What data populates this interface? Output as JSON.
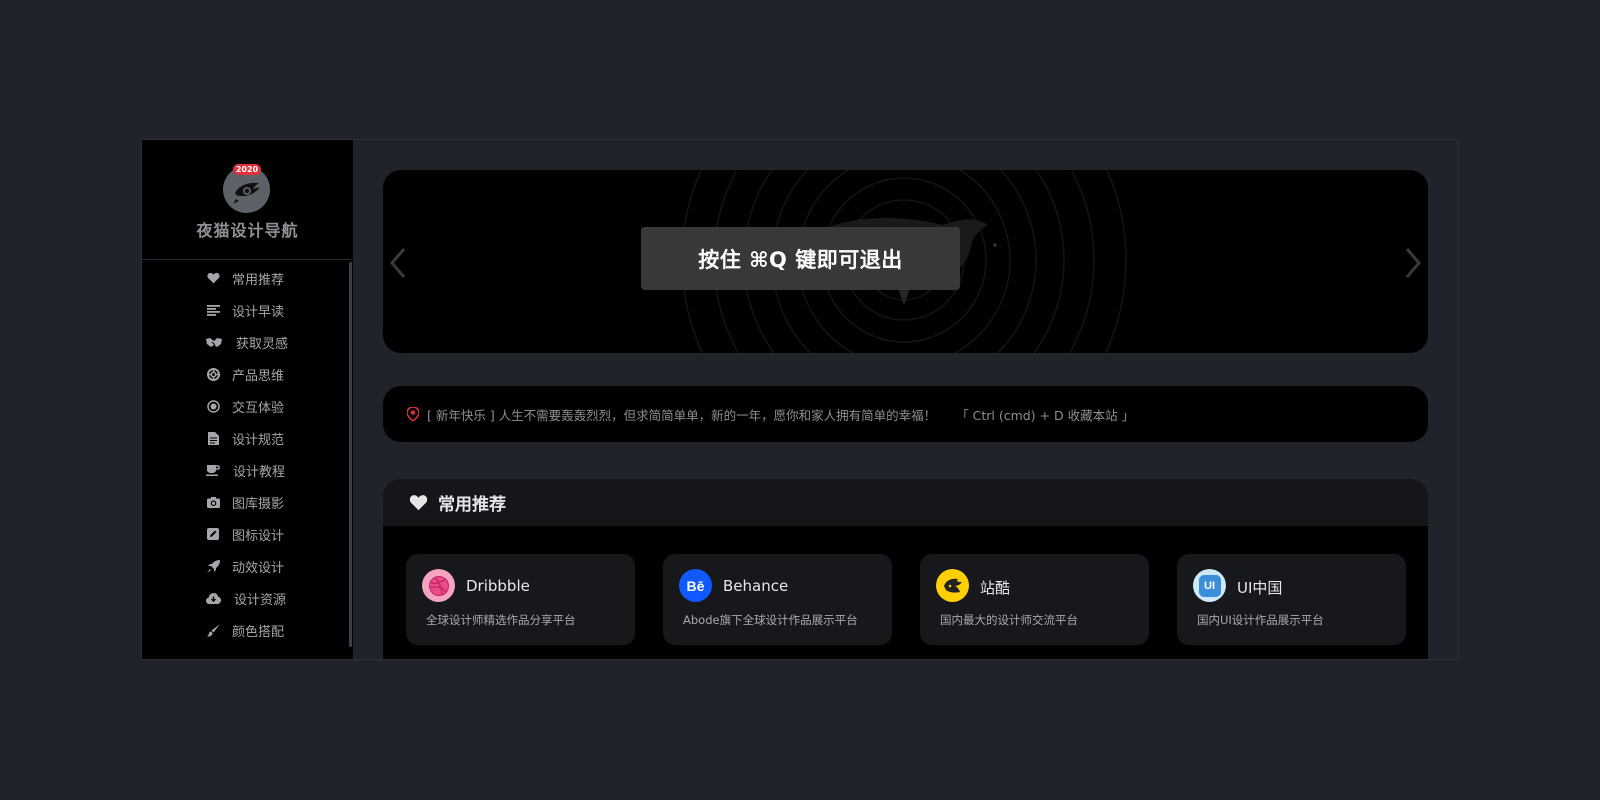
{
  "sidebar": {
    "logo_badge_text": "2020",
    "site_name": "夜猫设计导航",
    "items": [
      {
        "label": "常用推荐",
        "icon": "heart-icon"
      },
      {
        "label": "设计早读",
        "icon": "align-left-icon"
      },
      {
        "label": "获取灵感",
        "icon": "handshake-icon"
      },
      {
        "label": "产品思维",
        "icon": "life-ring-icon"
      },
      {
        "label": "交互体验",
        "icon": "dot-circle-icon"
      },
      {
        "label": "设计规范",
        "icon": "file-icon"
      },
      {
        "label": "设计教程",
        "icon": "coffee-cup-icon"
      },
      {
        "label": "图库摄影",
        "icon": "camera-icon"
      },
      {
        "label": "图标设计",
        "icon": "edit-square-icon"
      },
      {
        "label": "动效设计",
        "icon": "rocket-icon"
      },
      {
        "label": "设计资源",
        "icon": "cloud-download-icon"
      },
      {
        "label": "颜色搭配",
        "icon": "paint-brush-icon"
      }
    ]
  },
  "overlay": {
    "exit_fullscreen_hint": "按住 ⌘Q 键即可退出"
  },
  "notice": {
    "text": "[ 新年快乐 ]  人生不需要轰轰烈烈，但求简简单单，新的一年，愿你和家人拥有简单的幸福！",
    "shortcut": "「 Ctrl (cmd) + D 收藏本站 」"
  },
  "section": {
    "title": "常用推荐",
    "icon": "heart-icon",
    "cards": [
      {
        "name": "Dribbble",
        "desc": "全球设计师精选作品分享平台",
        "logo_bg": "#f5a3c1",
        "logo_color": "#ea4c89",
        "logo_text": ""
      },
      {
        "name": "Behance",
        "desc": "Abode旗下全球设计作品展示平台",
        "logo_bg": "#1059ff",
        "logo_color": "#ffffff",
        "logo_text": "Bē"
      },
      {
        "name": "站酷",
        "desc": "国内最大的设计师交流平台",
        "logo_bg": "#ffd000",
        "logo_color": "#222222",
        "logo_text": ""
      },
      {
        "name": "UI中国",
        "desc": "国内UI设计作品展示平台",
        "logo_bg": "#cfe7fb",
        "logo_color": "#3a8fd8",
        "logo_text": "UI"
      }
    ]
  },
  "colors": {
    "background": "#20232a",
    "sidebar": "#000000",
    "accent_badge": "#e0303b",
    "notice_pin": "#e0303b"
  }
}
